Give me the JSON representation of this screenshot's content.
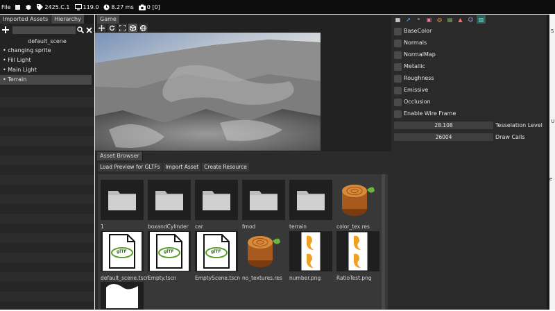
{
  "menubar": {
    "file": "File",
    "version": "2425.C.1",
    "fps": "119.0",
    "frame_time": "8.27 ms",
    "captures": "0 [0]"
  },
  "left_panel": {
    "tabs": [
      "Imported Assets",
      "Hierarchy"
    ],
    "scene_title": "default_scene",
    "items": [
      "changing sprite",
      "Fill Light",
      "Main Light",
      "Terrain"
    ],
    "selected_index": 3
  },
  "game": {
    "tab": "Game"
  },
  "assets": {
    "tab": "Asset Browser",
    "buttons": [
      "Load Preview for GLTFs",
      "Import Asset",
      "Create Resource"
    ],
    "row1": [
      {
        "name": "1",
        "kind": "folder"
      },
      {
        "name": "boxandCylinder",
        "kind": "folder"
      },
      {
        "name": "car",
        "kind": "folder"
      },
      {
        "name": "fmod",
        "kind": "folder"
      },
      {
        "name": "terrain",
        "kind": "folder"
      },
      {
        "name": "color_tex.res",
        "kind": "wood"
      }
    ],
    "row2": [
      {
        "name": "default_scene.tscn",
        "kind": "gltf"
      },
      {
        "name": "Empty.tscn",
        "kind": "gltf"
      },
      {
        "name": "EmptyScene.tscn",
        "kind": "gltf"
      },
      {
        "name": "no_textures.res",
        "kind": "wood"
      },
      {
        "name": "number.png",
        "kind": "image"
      },
      {
        "name": "RatioTest.png",
        "kind": "image"
      }
    ],
    "gltf_badge": "glTF"
  },
  "properties": {
    "toggles": [
      "BaseColor",
      "Normals",
      "NormalMap",
      "Metallic",
      "Roughness",
      "Emissive",
      "Occlusion",
      "Enable Wire Frame"
    ],
    "tesselation": {
      "value": "28.108",
      "label": "Tesselation Level"
    },
    "draw_calls": {
      "value": "26004",
      "label": "Draw Calls"
    }
  },
  "colors": {
    "accent": "#2e5f5f",
    "panel": "#252525"
  },
  "side_fragments": [
    "S",
    "y U",
    "ffe"
  ]
}
